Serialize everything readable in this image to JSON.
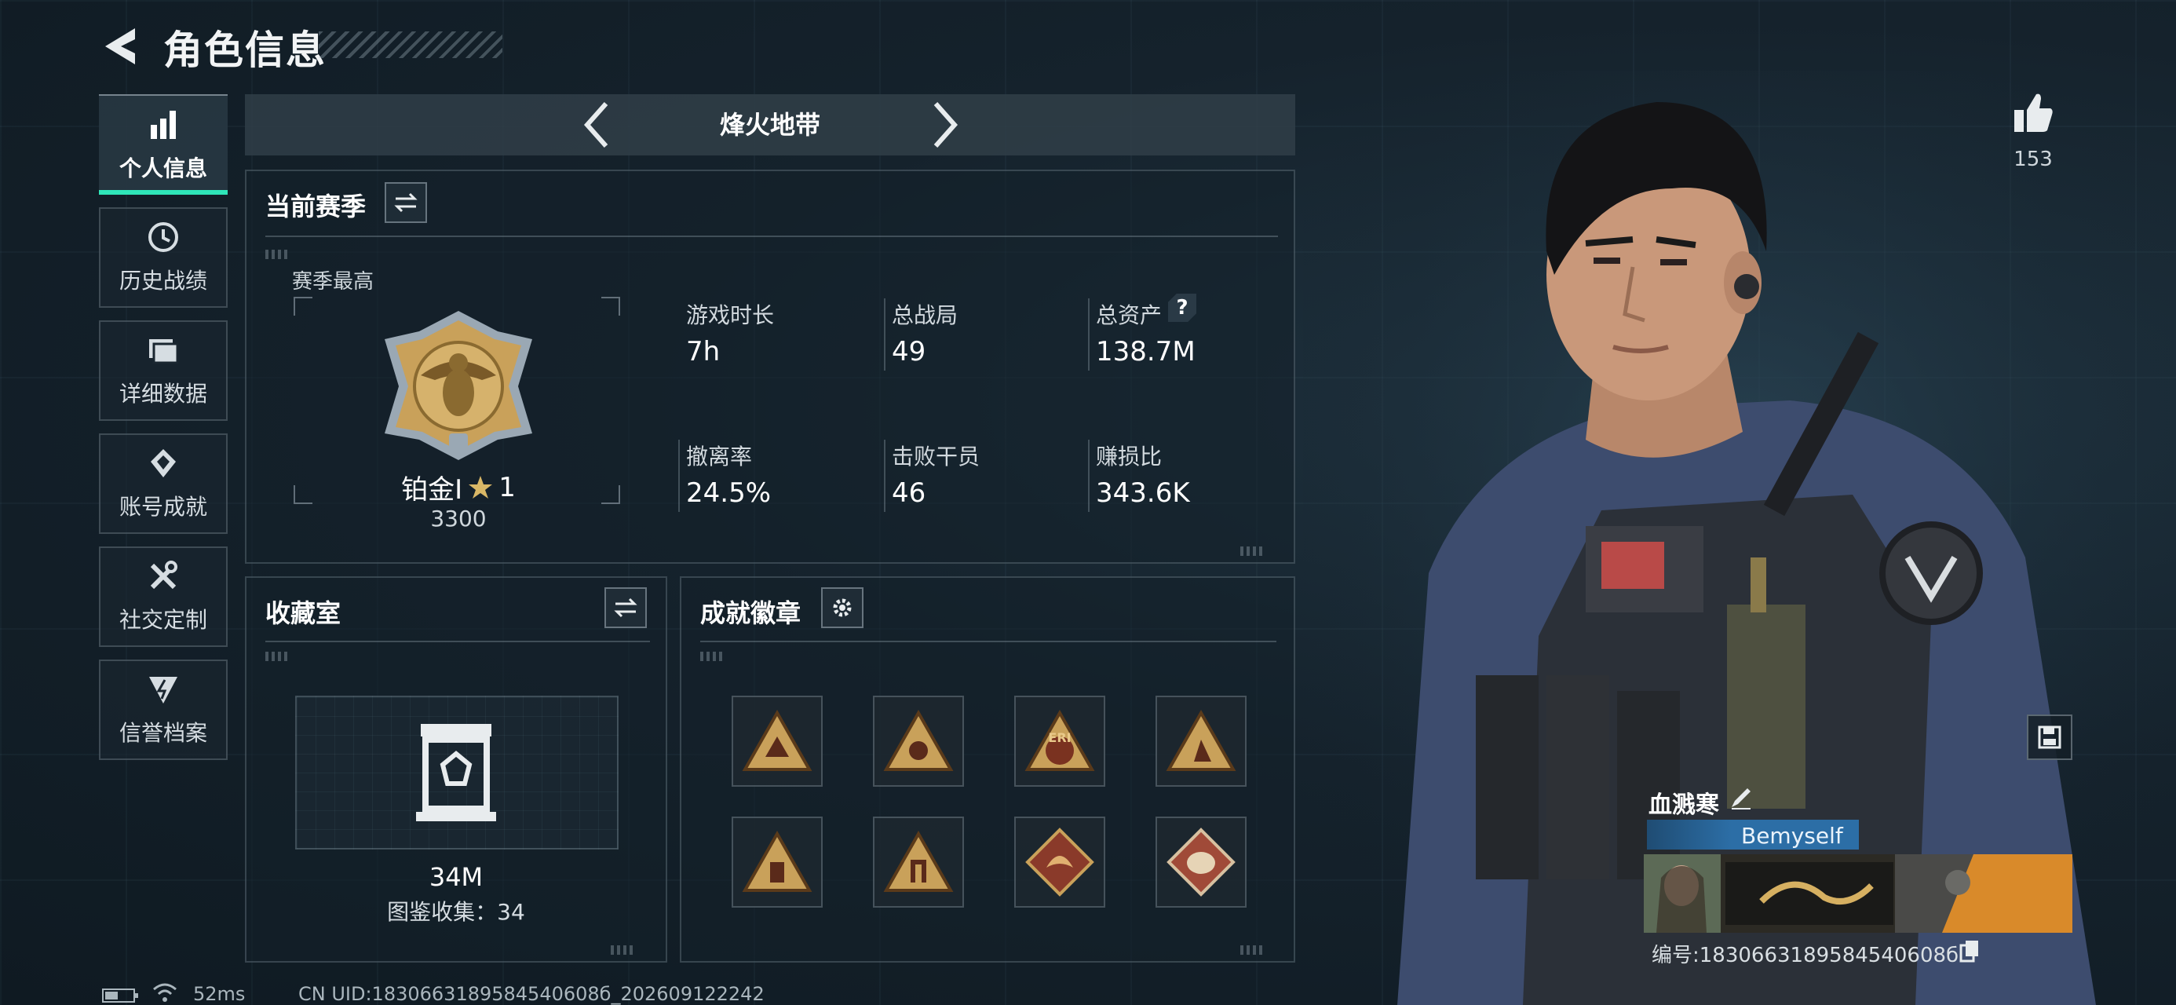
{
  "header": {
    "title": "角色信息"
  },
  "sidebar": {
    "items": [
      {
        "label": "个人信息",
        "icon": "bar-chart-icon",
        "active": true
      },
      {
        "label": "历史战绩",
        "icon": "clock-icon",
        "active": false
      },
      {
        "label": "详细数据",
        "icon": "folder-icon",
        "active": false
      },
      {
        "label": "账号成就",
        "icon": "achievement-icon",
        "active": false
      },
      {
        "label": "社交定制",
        "icon": "tools-icon",
        "active": false
      },
      {
        "label": "信誉档案",
        "icon": "shield-bolt-icon",
        "active": false
      }
    ]
  },
  "map_selector": {
    "name": "烽火地带"
  },
  "season": {
    "title": "当前赛季",
    "best_label": "赛季最高",
    "rank_name": "铂金I",
    "rank_stars": "1",
    "rank_points": "3300",
    "stats": [
      {
        "label": "游戏时长",
        "value": "7h"
      },
      {
        "label": "总战局",
        "value": "49"
      },
      {
        "label": "总资产",
        "value": "138.7M"
      },
      {
        "label": "撤离率",
        "value": "24.5%"
      },
      {
        "label": "击败干员",
        "value": "46"
      },
      {
        "label": "赚损比",
        "value": "343.6K"
      }
    ],
    "help_glyph": "?"
  },
  "collection": {
    "title": "收藏室",
    "value": "34M",
    "count_text": "图鉴收集：34"
  },
  "badges": {
    "title": "成就徽章",
    "items": [
      {
        "name": "triangle-badge-1",
        "label": ""
      },
      {
        "name": "triangle-badge-2",
        "label": ""
      },
      {
        "name": "triangle-badge-eri",
        "label": "ERI"
      },
      {
        "name": "triangle-badge-4",
        "label": ""
      },
      {
        "name": "triangle-badge-5",
        "label": ""
      },
      {
        "name": "triangle-badge-6",
        "label": ""
      },
      {
        "name": "diamond-badge-dragon",
        "label": ""
      },
      {
        "name": "diamond-badge-beast",
        "label": ""
      }
    ]
  },
  "likes": {
    "count": "153"
  },
  "character_card": {
    "name": "血溅寒",
    "title": "Bemyself",
    "id_text": "编号:1830663189584540608б"
  },
  "status_bar": {
    "ping": "52ms",
    "uid": "CN UID:1830663189584540608б_202609122242"
  },
  "colors": {
    "accent": "#2fe6b9",
    "gold": "#c9a15a"
  }
}
